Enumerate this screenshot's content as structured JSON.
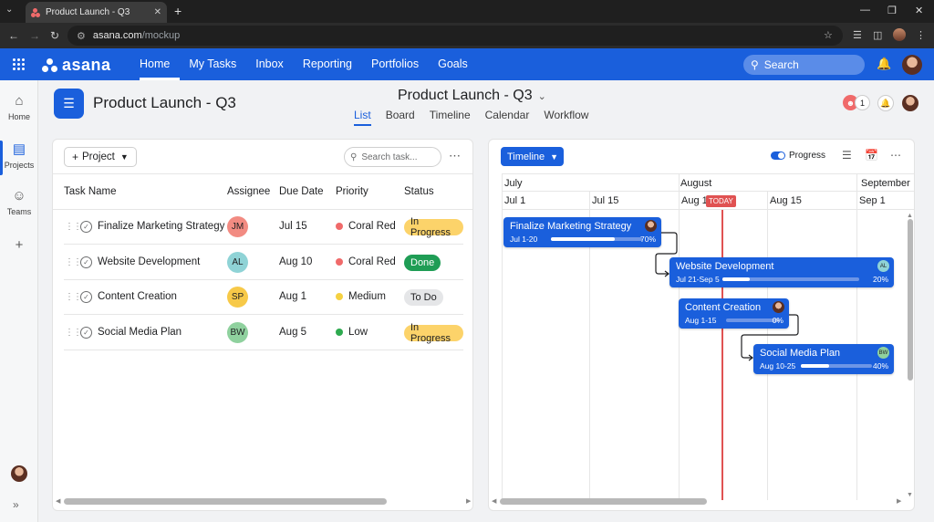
{
  "browser": {
    "tab_title": "Product Launch - Q3",
    "url_host": "asana.com",
    "url_path": "/mockup"
  },
  "app": {
    "logo": "asana",
    "nav": [
      "Home",
      "My Tasks",
      "Inbox",
      "Reporting",
      "Portfolios",
      "Goals"
    ],
    "active_nav": "Home",
    "search_placeholder": "Search"
  },
  "rail": {
    "items": [
      {
        "label": "Home",
        "icon": "home-icon"
      },
      {
        "label": "Projects",
        "icon": "projects-icon"
      },
      {
        "label": "Teams",
        "icon": "teams-icon"
      }
    ],
    "active": "Projects"
  },
  "project": {
    "title": "Product Launch - Q3",
    "center_title": "Product Launch - Q3",
    "views": [
      "List",
      "Board",
      "Timeline",
      "Calendar",
      "Workflow"
    ],
    "active_view": "List",
    "member_count": "1"
  },
  "list": {
    "project_button": "Project",
    "search_placeholder": "Search task...",
    "columns": [
      "Task Name",
      "Assignee",
      "Due Date",
      "Priority",
      "Status"
    ],
    "rows": [
      {
        "name": "Finalize Marketing Strategy",
        "assignee": "JM",
        "assignee_color": "#f28b82",
        "due": "Jul 15",
        "priority": "Coral Red",
        "priority_color": "#f06a6a",
        "status": "In Progress",
        "status_bg": "#fcd36a",
        "status_fg": "#1e1f21"
      },
      {
        "name": "Website Development",
        "assignee": "AL",
        "assignee_color": "#8fd3d6",
        "due": "Aug 10",
        "priority": "Coral Red",
        "priority_color": "#f06a6a",
        "status": "Done",
        "status_bg": "#1f9d55",
        "status_fg": "#ffffff"
      },
      {
        "name": "Content Creation",
        "assignee": "SP",
        "assignee_color": "#f7c948",
        "due": "Aug 1",
        "priority": "Medium",
        "priority_color": "#f5d142",
        "status": "To Do",
        "status_bg": "#e5e6e8",
        "status_fg": "#1e1f21"
      },
      {
        "name": "Social Media Plan",
        "assignee": "BW",
        "assignee_color": "#8fd19e",
        "due": "Aug 5",
        "priority": "Low",
        "priority_color": "#2eaa4f",
        "status": "In Progress",
        "status_bg": "#fcd36a",
        "status_fg": "#1e1f21"
      }
    ]
  },
  "timeline": {
    "view_button": "Timeline",
    "progress_label": "Progress",
    "months": [
      "July",
      "August",
      "September"
    ],
    "weeks": [
      "Jul 1",
      "Jul 15",
      "Aug 1",
      "Aug 15",
      "Sep 1"
    ],
    "today_label": "TODAY",
    "bars": [
      {
        "title": "Finalize Marketing Strategy",
        "dates": "Jul 1-20",
        "progress": 70,
        "pct_label": "70%",
        "avatar": ""
      },
      {
        "title": "Website Development",
        "dates": "Jul 21-Sep 5",
        "progress": 20,
        "pct_label": "20%",
        "avatar": "AL"
      },
      {
        "title": "Content Creation",
        "dates": "Aug 1-15",
        "progress": 0,
        "pct_label": "0%",
        "avatar": ""
      },
      {
        "title": "Social Media Plan",
        "dates": "Aug 10-25",
        "progress": 40,
        "pct_label": "40%",
        "avatar": "BW"
      }
    ]
  },
  "colors": {
    "brand": "#1a5fdc",
    "today": "#e05252"
  }
}
